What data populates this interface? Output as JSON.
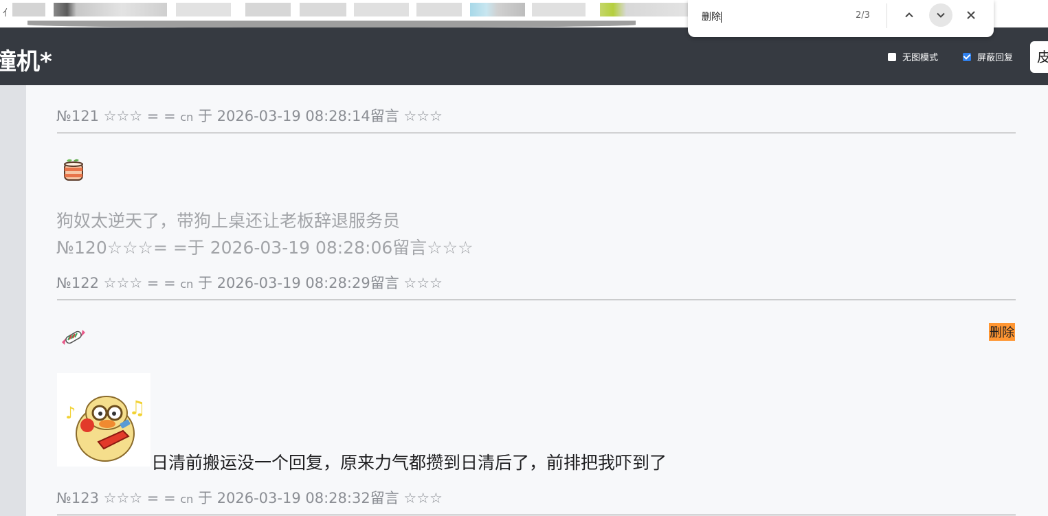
{
  "header": {
    "site_title": "撞机*",
    "options": [
      {
        "label": "无图模式",
        "checked": false
      },
      {
        "label": "屏蔽回复",
        "checked": true
      }
    ],
    "skin_button_label": "皮"
  },
  "findbar": {
    "query": "删除",
    "count": "2/3"
  },
  "posts": [
    {
      "meta": {
        "number": "№121",
        "stars_left": "☆☆☆",
        "user": "= =",
        "tld": "cn",
        "time_text": "于 2026-03-19 08:28:14留言",
        "stars_right": "☆☆☆"
      },
      "quote_text": "狗奴太逆天了，带狗上桌还让老板辞退服务员",
      "quote_meta": "№120☆☆☆= =于 2026-03-19 08:28:06留言☆☆☆"
    },
    {
      "meta": {
        "number": "№122",
        "stars_left": "☆☆☆",
        "user": "= =",
        "tld": "cn",
        "time_text": "于 2026-03-19 08:28:29留言",
        "stars_right": "☆☆☆"
      },
      "delete_label": "删除",
      "text": "日清前搬运没一个回复，原来力气都攒到日清后了，前排把我吓到了"
    },
    {
      "meta": {
        "number": "№123",
        "stars_left": "☆☆☆",
        "user": "= =",
        "tld": "cn",
        "time_text": "于 2026-03-19 08:28:32留言",
        "stars_right": "☆☆☆"
      }
    }
  ],
  "colors": {
    "header_bg": "#363a41",
    "highlight": "#ff9632",
    "checkbox_accent": "#2f80ed"
  }
}
